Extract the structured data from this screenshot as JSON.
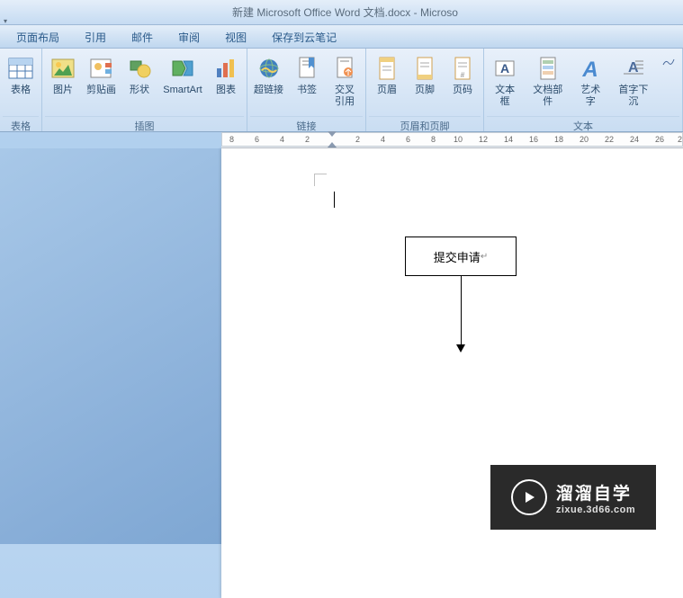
{
  "title": "新建 Microsoft Office Word 文档.docx - Microso",
  "menu": {
    "items": [
      "页面布局",
      "引用",
      "邮件",
      "审阅",
      "视图",
      "保存到云笔记"
    ]
  },
  "ribbon": {
    "groups": [
      {
        "label": "表格",
        "buttons": [
          {
            "label": "表格",
            "icon": "table-icon"
          }
        ]
      },
      {
        "label": "插图",
        "buttons": [
          {
            "label": "图片",
            "icon": "picture-icon"
          },
          {
            "label": "剪贴画",
            "icon": "clipart-icon"
          },
          {
            "label": "形状",
            "icon": "shapes-icon"
          },
          {
            "label": "SmartArt",
            "icon": "smartart-icon"
          },
          {
            "label": "图表",
            "icon": "chart-icon"
          }
        ]
      },
      {
        "label": "链接",
        "buttons": [
          {
            "label": "超链接",
            "icon": "hyperlink-icon"
          },
          {
            "label": "书签",
            "icon": "bookmark-icon"
          },
          {
            "label": "交叉\n引用",
            "icon": "crossref-icon"
          }
        ]
      },
      {
        "label": "页眉和页脚",
        "buttons": [
          {
            "label": "页眉",
            "icon": "header-icon"
          },
          {
            "label": "页脚",
            "icon": "footer-icon"
          },
          {
            "label": "页码",
            "icon": "pagenum-icon"
          }
        ]
      },
      {
        "label": "文本",
        "buttons": [
          {
            "label": "文本框",
            "icon": "textbox-icon"
          },
          {
            "label": "文档部件",
            "icon": "quickparts-icon"
          },
          {
            "label": "艺术字",
            "icon": "wordart-icon"
          },
          {
            "label": "首字下沉",
            "icon": "dropcap-icon"
          }
        ]
      }
    ]
  },
  "ruler": {
    "ticks": [
      "8",
      "6",
      "4",
      "2",
      "",
      "2",
      "4",
      "6",
      "8",
      "10",
      "12",
      "14",
      "16",
      "18",
      "20",
      "22",
      "24",
      "26",
      "2"
    ]
  },
  "document": {
    "flowchart_text": "提交申请"
  },
  "watermark": {
    "title": "溜溜自学",
    "sub": "zixue.3d66.com"
  }
}
